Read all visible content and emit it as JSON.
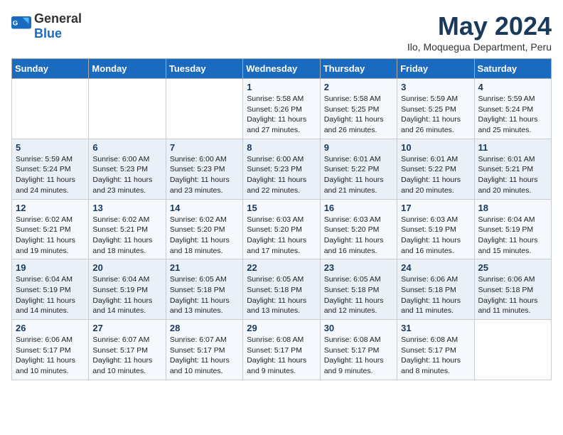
{
  "logo": {
    "text_general": "General",
    "text_blue": "Blue"
  },
  "header": {
    "title": "May 2024",
    "subtitle": "Ilo, Moquegua Department, Peru"
  },
  "days_of_week": [
    "Sunday",
    "Monday",
    "Tuesday",
    "Wednesday",
    "Thursday",
    "Friday",
    "Saturday"
  ],
  "weeks": [
    [
      {
        "day": "",
        "info": ""
      },
      {
        "day": "",
        "info": ""
      },
      {
        "day": "",
        "info": ""
      },
      {
        "day": "1",
        "info": "Sunrise: 5:58 AM\nSunset: 5:26 PM\nDaylight: 11 hours\nand 27 minutes."
      },
      {
        "day": "2",
        "info": "Sunrise: 5:58 AM\nSunset: 5:25 PM\nDaylight: 11 hours\nand 26 minutes."
      },
      {
        "day": "3",
        "info": "Sunrise: 5:59 AM\nSunset: 5:25 PM\nDaylight: 11 hours\nand 26 minutes."
      },
      {
        "day": "4",
        "info": "Sunrise: 5:59 AM\nSunset: 5:24 PM\nDaylight: 11 hours\nand 25 minutes."
      }
    ],
    [
      {
        "day": "5",
        "info": "Sunrise: 5:59 AM\nSunset: 5:24 PM\nDaylight: 11 hours\nand 24 minutes."
      },
      {
        "day": "6",
        "info": "Sunrise: 6:00 AM\nSunset: 5:23 PM\nDaylight: 11 hours\nand 23 minutes."
      },
      {
        "day": "7",
        "info": "Sunrise: 6:00 AM\nSunset: 5:23 PM\nDaylight: 11 hours\nand 23 minutes."
      },
      {
        "day": "8",
        "info": "Sunrise: 6:00 AM\nSunset: 5:23 PM\nDaylight: 11 hours\nand 22 minutes."
      },
      {
        "day": "9",
        "info": "Sunrise: 6:01 AM\nSunset: 5:22 PM\nDaylight: 11 hours\nand 21 minutes."
      },
      {
        "day": "10",
        "info": "Sunrise: 6:01 AM\nSunset: 5:22 PM\nDaylight: 11 hours\nand 20 minutes."
      },
      {
        "day": "11",
        "info": "Sunrise: 6:01 AM\nSunset: 5:21 PM\nDaylight: 11 hours\nand 20 minutes."
      }
    ],
    [
      {
        "day": "12",
        "info": "Sunrise: 6:02 AM\nSunset: 5:21 PM\nDaylight: 11 hours\nand 19 minutes."
      },
      {
        "day": "13",
        "info": "Sunrise: 6:02 AM\nSunset: 5:21 PM\nDaylight: 11 hours\nand 18 minutes."
      },
      {
        "day": "14",
        "info": "Sunrise: 6:02 AM\nSunset: 5:20 PM\nDaylight: 11 hours\nand 18 minutes."
      },
      {
        "day": "15",
        "info": "Sunrise: 6:03 AM\nSunset: 5:20 PM\nDaylight: 11 hours\nand 17 minutes."
      },
      {
        "day": "16",
        "info": "Sunrise: 6:03 AM\nSunset: 5:20 PM\nDaylight: 11 hours\nand 16 minutes."
      },
      {
        "day": "17",
        "info": "Sunrise: 6:03 AM\nSunset: 5:19 PM\nDaylight: 11 hours\nand 16 minutes."
      },
      {
        "day": "18",
        "info": "Sunrise: 6:04 AM\nSunset: 5:19 PM\nDaylight: 11 hours\nand 15 minutes."
      }
    ],
    [
      {
        "day": "19",
        "info": "Sunrise: 6:04 AM\nSunset: 5:19 PM\nDaylight: 11 hours\nand 14 minutes."
      },
      {
        "day": "20",
        "info": "Sunrise: 6:04 AM\nSunset: 5:19 PM\nDaylight: 11 hours\nand 14 minutes."
      },
      {
        "day": "21",
        "info": "Sunrise: 6:05 AM\nSunset: 5:18 PM\nDaylight: 11 hours\nand 13 minutes."
      },
      {
        "day": "22",
        "info": "Sunrise: 6:05 AM\nSunset: 5:18 PM\nDaylight: 11 hours\nand 13 minutes."
      },
      {
        "day": "23",
        "info": "Sunrise: 6:05 AM\nSunset: 5:18 PM\nDaylight: 11 hours\nand 12 minutes."
      },
      {
        "day": "24",
        "info": "Sunrise: 6:06 AM\nSunset: 5:18 PM\nDaylight: 11 hours\nand 11 minutes."
      },
      {
        "day": "25",
        "info": "Sunrise: 6:06 AM\nSunset: 5:18 PM\nDaylight: 11 hours\nand 11 minutes."
      }
    ],
    [
      {
        "day": "26",
        "info": "Sunrise: 6:06 AM\nSunset: 5:17 PM\nDaylight: 11 hours\nand 10 minutes."
      },
      {
        "day": "27",
        "info": "Sunrise: 6:07 AM\nSunset: 5:17 PM\nDaylight: 11 hours\nand 10 minutes."
      },
      {
        "day": "28",
        "info": "Sunrise: 6:07 AM\nSunset: 5:17 PM\nDaylight: 11 hours\nand 10 minutes."
      },
      {
        "day": "29",
        "info": "Sunrise: 6:08 AM\nSunset: 5:17 PM\nDaylight: 11 hours\nand 9 minutes."
      },
      {
        "day": "30",
        "info": "Sunrise: 6:08 AM\nSunset: 5:17 PM\nDaylight: 11 hours\nand 9 minutes."
      },
      {
        "day": "31",
        "info": "Sunrise: 6:08 AM\nSunset: 5:17 PM\nDaylight: 11 hours\nand 8 minutes."
      },
      {
        "day": "",
        "info": ""
      }
    ]
  ]
}
